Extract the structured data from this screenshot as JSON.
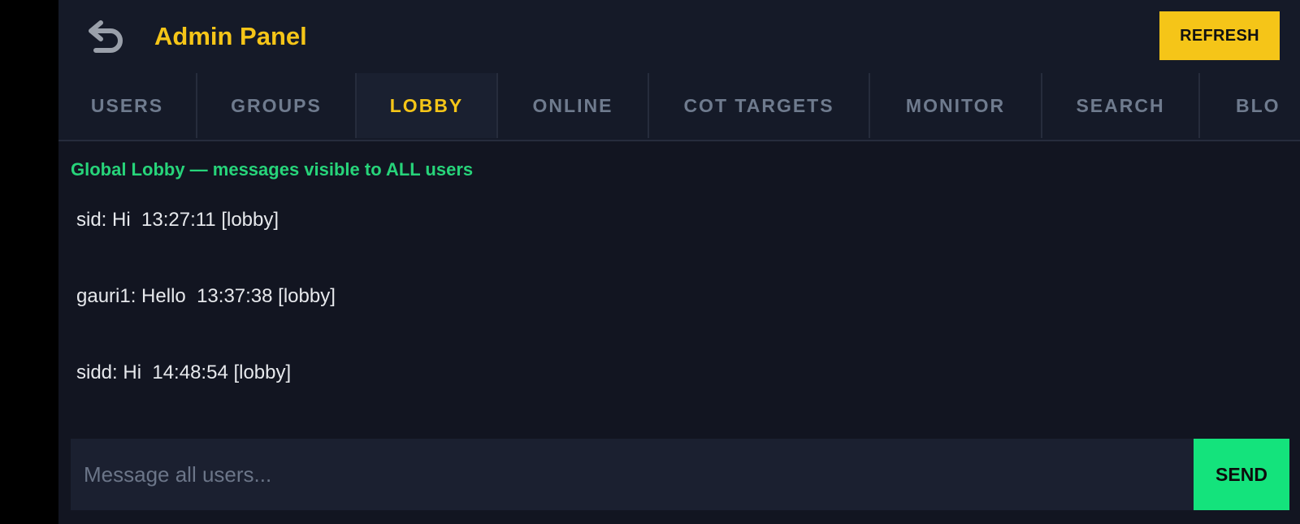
{
  "header": {
    "title": "Admin Panel",
    "back_icon": "undo-arrow-icon",
    "refresh_label": "REFRESH"
  },
  "tabs": [
    {
      "label": "USERS",
      "active": false
    },
    {
      "label": "GROUPS",
      "active": false
    },
    {
      "label": "LOBBY",
      "active": true
    },
    {
      "label": "ONLINE",
      "active": false
    },
    {
      "label": "COT TARGETS",
      "active": false
    },
    {
      "label": "MONITOR",
      "active": false
    },
    {
      "label": "SEARCH",
      "active": false
    },
    {
      "label": "BLO",
      "active": false
    }
  ],
  "lobby": {
    "banner": "Global Lobby — messages visible to ALL users",
    "messages": [
      {
        "text": "sid: Hi  13:27:11 [lobby]"
      },
      {
        "text": "gauri1: Hello  13:37:38 [lobby]"
      },
      {
        "text": "sidd: Hi  14:48:54 [lobby]"
      }
    ]
  },
  "composer": {
    "placeholder": "Message all users...",
    "value": "",
    "send_label": "SEND"
  },
  "colors": {
    "accent_yellow": "#f5c518",
    "accent_green": "#27d47a",
    "send_green": "#14e37c",
    "background": "#121521"
  }
}
